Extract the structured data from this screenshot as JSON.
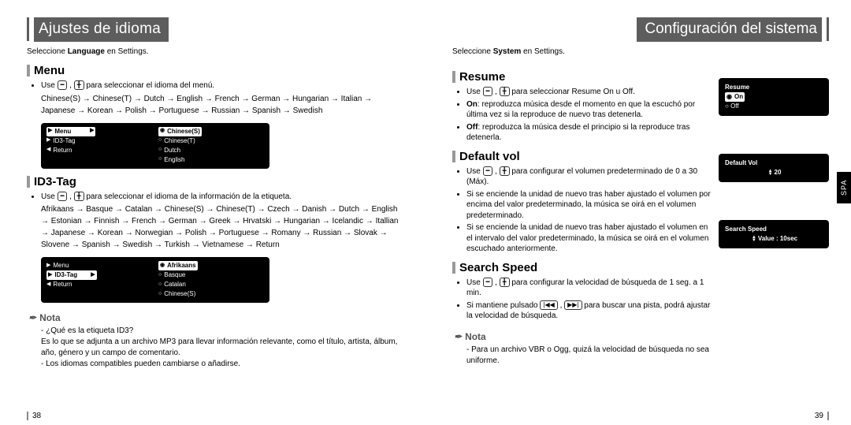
{
  "left": {
    "title": "Ajustes de idioma",
    "instr_pre": "Seleccione ",
    "instr_bold": "Language",
    "instr_post": " en Settings.",
    "menu": {
      "head": "Menu",
      "use": "Use ",
      "use_post": " para seleccionar el idioma del menú.",
      "langs": "Chinese(S) → Chinese(T) → Dutch → English → French → German → Hungarian → Italian → Japanese → Korean → Polish → Portuguese → Russian → Spanish → Swedish",
      "lcd_left": [
        "Menu",
        "ID3-Tag",
        "Return"
      ],
      "lcd_left_selected_index": 0,
      "lcd_right": [
        "Chinese(S)",
        "Chinese(T)",
        "Dutch",
        "English"
      ],
      "lcd_right_selected_index": 0
    },
    "id3": {
      "head": "ID3-Tag",
      "use": "Use ",
      "use_post": " para seleccionar el idioma de la información de la etiqueta.",
      "langs": "Afrikaans → Basque → Catalan → Chinese(S) → Chinese(T) → Czech → Danish → Dutch → English → Estonian → Finnish → French → German → Greek → Hrvatski → Hungarian → Icelandic → Itallian → Japanese → Korean → Norwegian → Polish → Portuguese → Romany → Russian → Slovak → Slovene → Spanish → Swedish → Turkish → Vietnamese → Return",
      "lcd_left": [
        "Menu",
        "ID3-Tag",
        "Return"
      ],
      "lcd_left_selected_index": 1,
      "lcd_right": [
        "Afrikaans",
        "Basque",
        "Catalan",
        "Chinese(S)"
      ],
      "lcd_right_selected_index": 0
    },
    "note_head": "Nota",
    "note1_q": "¿Qué es la etiqueta ID3?",
    "note1_a": "Es lo que se adjunta a un archivo MP3 para llevar información relevante, como el título, artista, álbum, año, género y un campo de comentario.",
    "note2": "Los idiomas compatibles pueden cambiarse o añadirse.",
    "page_no": "38"
  },
  "right": {
    "title": "Configuración del sistema",
    "instr_pre": "Seleccione ",
    "instr_bold": "System",
    "instr_post": " en Settings.",
    "side_tab": "SPA",
    "resume": {
      "head": "Resume",
      "use": "Use ",
      "use_post": " para seleccionar Resume On u Off.",
      "on_b": "On",
      "on_t": ": reproduzca música desde el momento en que la escuchó por última vez si la reproduce de nuevo tras detenerla.",
      "off_b": "Off",
      "off_t": ": reproduzca la música desde el principio si la reproduce tras detenerla.",
      "lcd": {
        "title": "Resume",
        "opt_sel": "On",
        "opt2": "Off"
      }
    },
    "defvol": {
      "head": "Default vol",
      "use": "Use ",
      "use_post": " para configurar el volumen predeterminado de 0 a 30 (Máx).",
      "b1": "Si se enciende la unidad de nuevo tras haber ajustado el volumen por encima del valor predeterminado, la música se oirá en el volumen predeterminado.",
      "b2": "Si se enciende la unidad de nuevo tras haber ajustado el volumen en el intervalo del valor predeterminado, la música se oirá en el volumen escuchado anteriormente.",
      "lcd": {
        "title": "Default Vol",
        "value": "20"
      }
    },
    "search": {
      "head": "Search Speed",
      "use": "Use ",
      "use_post": " para configurar la velocidad de búsqueda de 1 seg. a 1 min.",
      "b1_pre": "Si mantiene pulsado ",
      "b1_post": " para buscar una pista, podrá ajustar la velocidad de búsqueda.",
      "lcd": {
        "title": "Search Speed",
        "value": "Value : 10sec"
      }
    },
    "note_head": "Nota",
    "note1": "Para un archivo VBR o Ogg, quizá la velocidad de búsqueda no sea uniforme.",
    "page_no": "39"
  }
}
